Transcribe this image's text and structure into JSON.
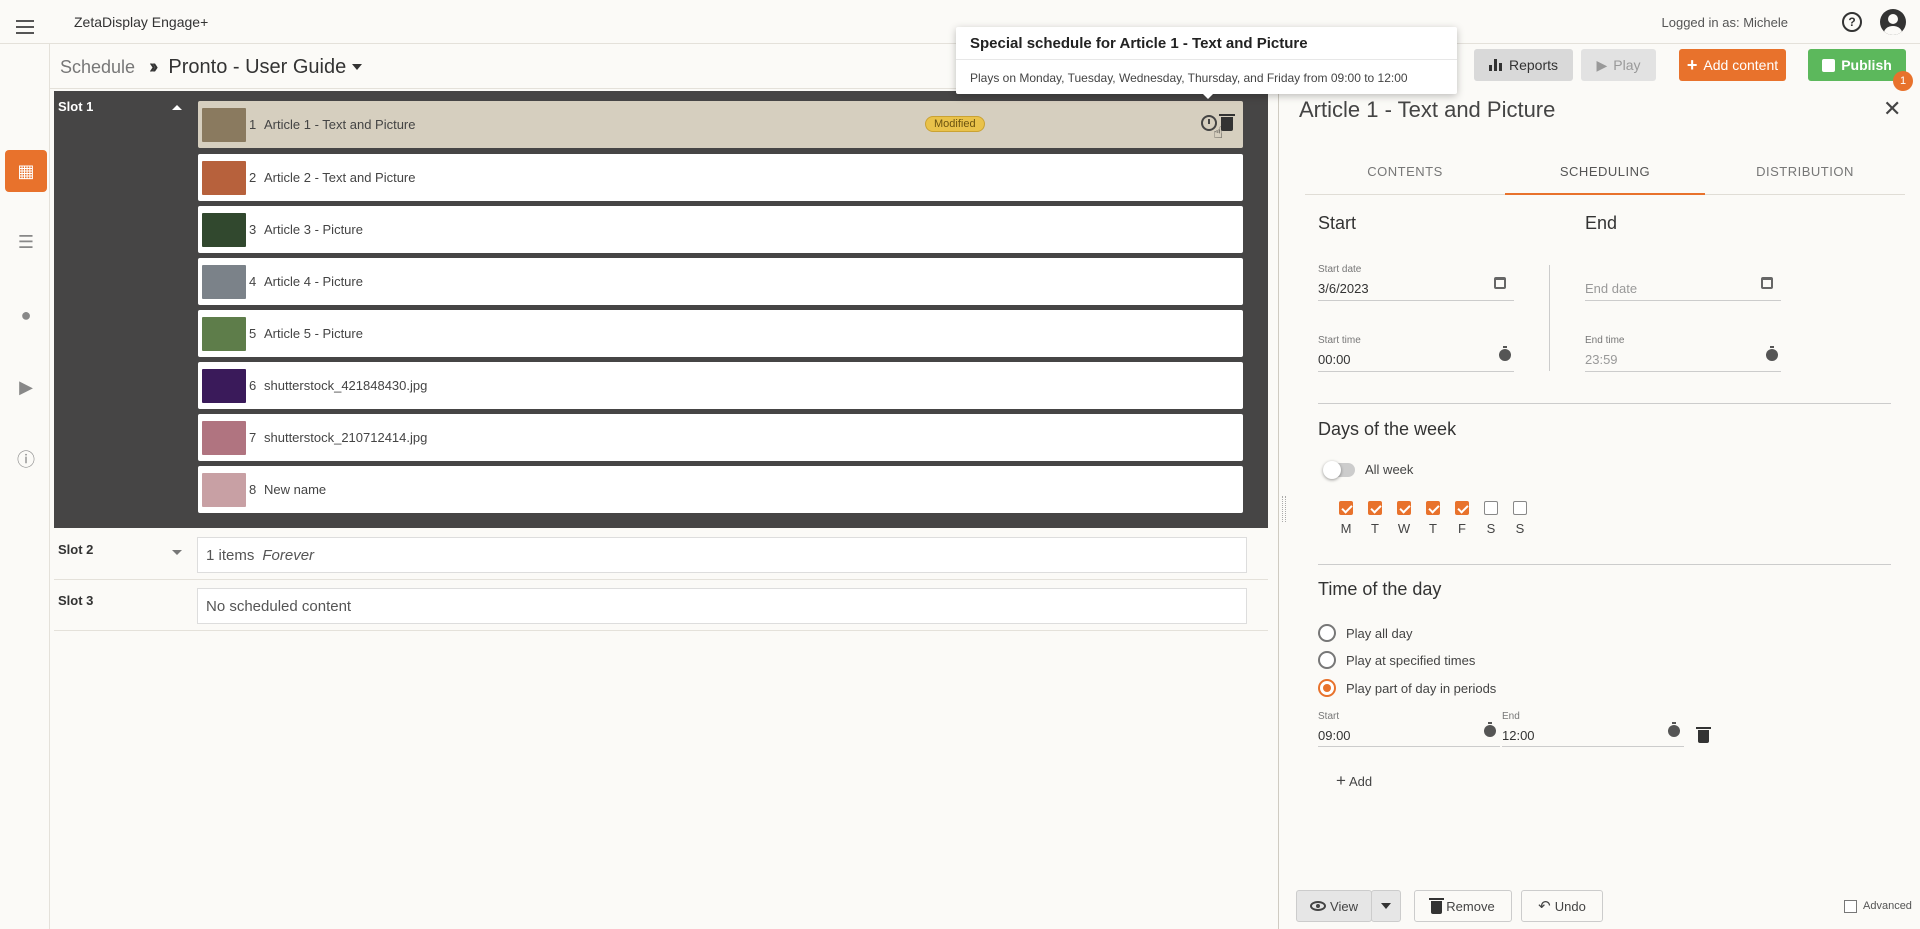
{
  "app": {
    "title": "ZetaDisplay Engage+",
    "logged_in": "Logged in as: Michele"
  },
  "breadcrumb": {
    "root": "Schedule",
    "separator": "»",
    "current": "Pronto - User Guide"
  },
  "toolbar": {
    "reports": "Reports",
    "play": "Play",
    "add_content": "Add content",
    "publish": "Publish",
    "publish_badge": "1"
  },
  "tooltip": {
    "title": "Special schedule for Article 1 - Text and Picture",
    "body": "Plays on Monday, Tuesday, Wednesday, Thursday, and Friday from 09:00 to 12:00"
  },
  "slots": {
    "slot1": {
      "label": "Slot 1",
      "items": [
        {
          "num": "1",
          "name": "Article 1 - Text and Picture",
          "badge": "Modified",
          "thumb": "#8a7a5f"
        },
        {
          "num": "2",
          "name": "Article 2 - Text and Picture",
          "thumb": "#b7613c"
        },
        {
          "num": "3",
          "name": "Article 3 - Picture",
          "thumb": "#31482e"
        },
        {
          "num": "4",
          "name": "Article 4 - Picture",
          "thumb": "#7b8289"
        },
        {
          "num": "5",
          "name": "Article 5 - Picture",
          "thumb": "#5e7d4a"
        },
        {
          "num": "6",
          "name": "shutterstock_421848430.jpg",
          "thumb": "#3a1a5a"
        },
        {
          "num": "7",
          "name": "shutterstock_210712414.jpg",
          "thumb": "#b07480"
        },
        {
          "num": "8",
          "name": "New name",
          "thumb": "#c8a0a4"
        }
      ]
    },
    "slot2": {
      "label": "Slot 2",
      "count": "1 items",
      "duration": "Forever"
    },
    "slot3": {
      "label": "Slot 3",
      "text": "No scheduled content"
    }
  },
  "panel": {
    "title": "Article 1 - Text and Picture",
    "tabs": [
      "CONTENTS",
      "SCHEDULING",
      "DISTRIBUTION"
    ],
    "active_tab": "SCHEDULING",
    "start": {
      "heading": "Start",
      "date_label": "Start date",
      "date_value": "3/6/2023",
      "time_label": "Start time",
      "time_value": "00:00"
    },
    "end": {
      "heading": "End",
      "date_placeholder": "End date",
      "time_label": "End time",
      "time_value": "23:59"
    },
    "days": {
      "heading": "Days of the week",
      "all_week_label": "All week",
      "all_week_on": false,
      "list": [
        {
          "letter": "M",
          "checked": true
        },
        {
          "letter": "T",
          "checked": true
        },
        {
          "letter": "W",
          "checked": true
        },
        {
          "letter": "T",
          "checked": true
        },
        {
          "letter": "F",
          "checked": true
        },
        {
          "letter": "S",
          "checked": false
        },
        {
          "letter": "S",
          "checked": false
        }
      ]
    },
    "time_of_day": {
      "heading": "Time of the day",
      "options": [
        "Play all day",
        "Play at specified times",
        "Play part of day in periods"
      ],
      "selected": "Play part of day in periods",
      "period": {
        "start_label": "Start",
        "start_value": "09:00",
        "end_label": "End",
        "end_value": "12:00"
      },
      "add_label": "Add"
    },
    "footer": {
      "view": "View",
      "remove": "Remove",
      "undo": "Undo",
      "advanced": "Advanced"
    }
  },
  "colors": {
    "accent": "#e8722c",
    "publish": "#5cb85c",
    "slot_bg": "#464545",
    "badge": "#e9c24a"
  }
}
